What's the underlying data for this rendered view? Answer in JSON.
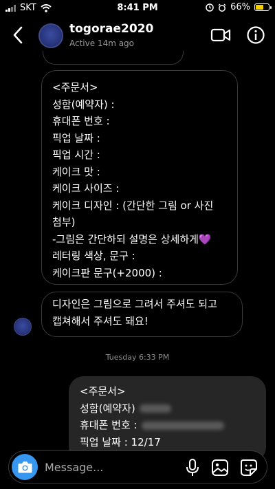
{
  "status_bar": {
    "carrier": "SKT",
    "time": "8:41 PM",
    "battery_percent": "66%",
    "battery_level": 0.66,
    "battery_color": "#f5d000"
  },
  "header": {
    "back_icon": "chevron-left-icon",
    "contact_name": "togorae2020",
    "contact_status": "Active 14m ago",
    "video_icon": "video-camera-icon",
    "info_icon": "info-icon"
  },
  "messages": {
    "order_form_lines": [
      "<주문서>",
      "성함(예약자) :",
      "휴대폰 번호 :",
      "픽업 날짜 :",
      "픽업 시간 :",
      "케이크 맛 :",
      "케이크 사이즈 :",
      "케이크 디자인 : (간단한 그림 or 사진",
      "첨부)",
      "-그림은 간단하되 설명은 상세하게💜",
      "레터링 색상, 문구 :",
      "케이크판 문구(+2000) :"
    ],
    "design_note_lines": [
      "디자인은 그림으로 그려서 주셔도 되고",
      "캡쳐해서 주셔도 돼요!"
    ],
    "timestamp": "Tuesday 6:33 PM",
    "reply_lines": [
      "<주문서>",
      "성함(예약자)",
      "휴대폰 번호 :",
      "픽업 날짜 : 12/17"
    ]
  },
  "composer": {
    "placeholder": "Message...",
    "value": "",
    "accent_color": "#3797f0"
  }
}
